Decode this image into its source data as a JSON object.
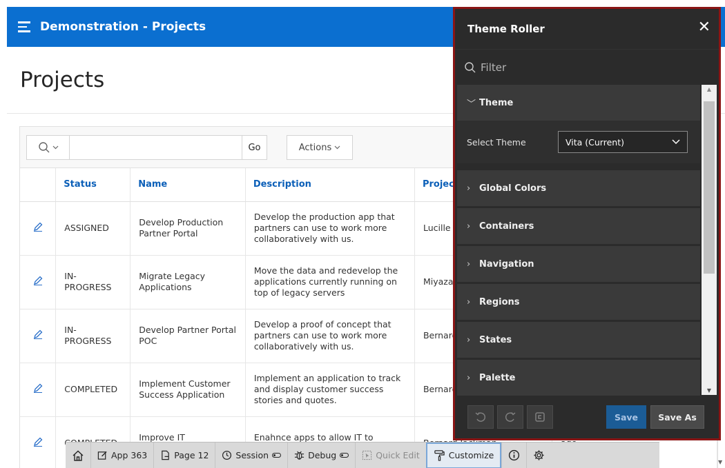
{
  "header": {
    "app_title": "Demonstration - Projects"
  },
  "page": {
    "title": "Projects"
  },
  "report": {
    "go_label": "Go",
    "actions_label": "Actions",
    "columns": [
      "",
      "Status",
      "Name",
      "Description",
      "Project",
      ""
    ],
    "rows": [
      {
        "status": "ASSIGNED",
        "name": "Develop Production Partner Portal",
        "description": "Develop the production app that partners can use to work more collaboratively with us.",
        "project_lead": "Lucille Beatie",
        "extra": ""
      },
      {
        "status": "IN-PROGRESS",
        "name": "Migrate Legacy Applications",
        "description": "Move the data and redevelop the applications currently running on top of legacy servers",
        "project_lead": "Miyazaki Yokohama",
        "extra": ""
      },
      {
        "status": "IN-PROGRESS",
        "name": "Develop Partner Portal POC",
        "description": "Develop a proof of concept that partners can use to work more collaboratively with us.",
        "project_lead": "Bernard Jackman",
        "extra": ""
      },
      {
        "status": "COMPLETED",
        "name": "Implement Customer Success Application",
        "description": "Implement an application to track and display customer success stories and quotes.",
        "project_lead": "Bernard Jackman",
        "extra": ""
      },
      {
        "status": "COMPLETED",
        "name": "Improve IT Management Apps",
        "description": "Enahnce apps to allow IT to manage resources",
        "project_lead": "Bernard Jackman",
        "extra": "ago"
      }
    ]
  },
  "theme_roller": {
    "title": "Theme Roller",
    "filter_placeholder": "Filter",
    "theme_section": "Theme",
    "select_theme_label": "Select Theme",
    "select_theme_value": "Vita (Current)",
    "sections": [
      "Global Colors",
      "Containers",
      "Navigation",
      "Regions",
      "States",
      "Palette"
    ],
    "save_label": "Save",
    "save_as_label": "Save As"
  },
  "dev_bar": {
    "app": "App 363",
    "page": "Page 12",
    "session": "Session",
    "debug": "Debug",
    "quick_edit": "Quick Edit",
    "customize": "Customize"
  },
  "colors": {
    "header": "#0b6fd0",
    "link": "#0b5fb8",
    "panel": "#2b2b2b",
    "panel_border": "#8a1515",
    "save": "#1b5c96"
  }
}
